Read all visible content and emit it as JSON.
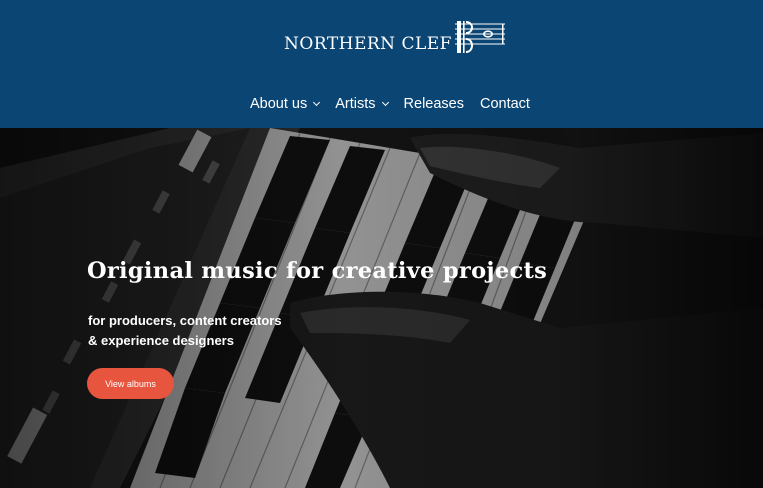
{
  "header": {
    "logo_text": "NORTHERN CLEF",
    "background_color": "#0b4573"
  },
  "nav": {
    "items": [
      {
        "label": "About us",
        "has_dropdown": true
      },
      {
        "label": "Artists",
        "has_dropdown": true
      },
      {
        "label": "Releases",
        "has_dropdown": false
      },
      {
        "label": "Contact",
        "has_dropdown": false
      }
    ]
  },
  "hero": {
    "title": "Original music for creative projects",
    "subtitle_line1": "for producers, content creators",
    "subtitle_line2": "& experience designers",
    "cta_label": "View albums",
    "cta_color": "#e8553f",
    "background_image": "black-and-white photo of hands playing a synthesizer keyboard"
  }
}
